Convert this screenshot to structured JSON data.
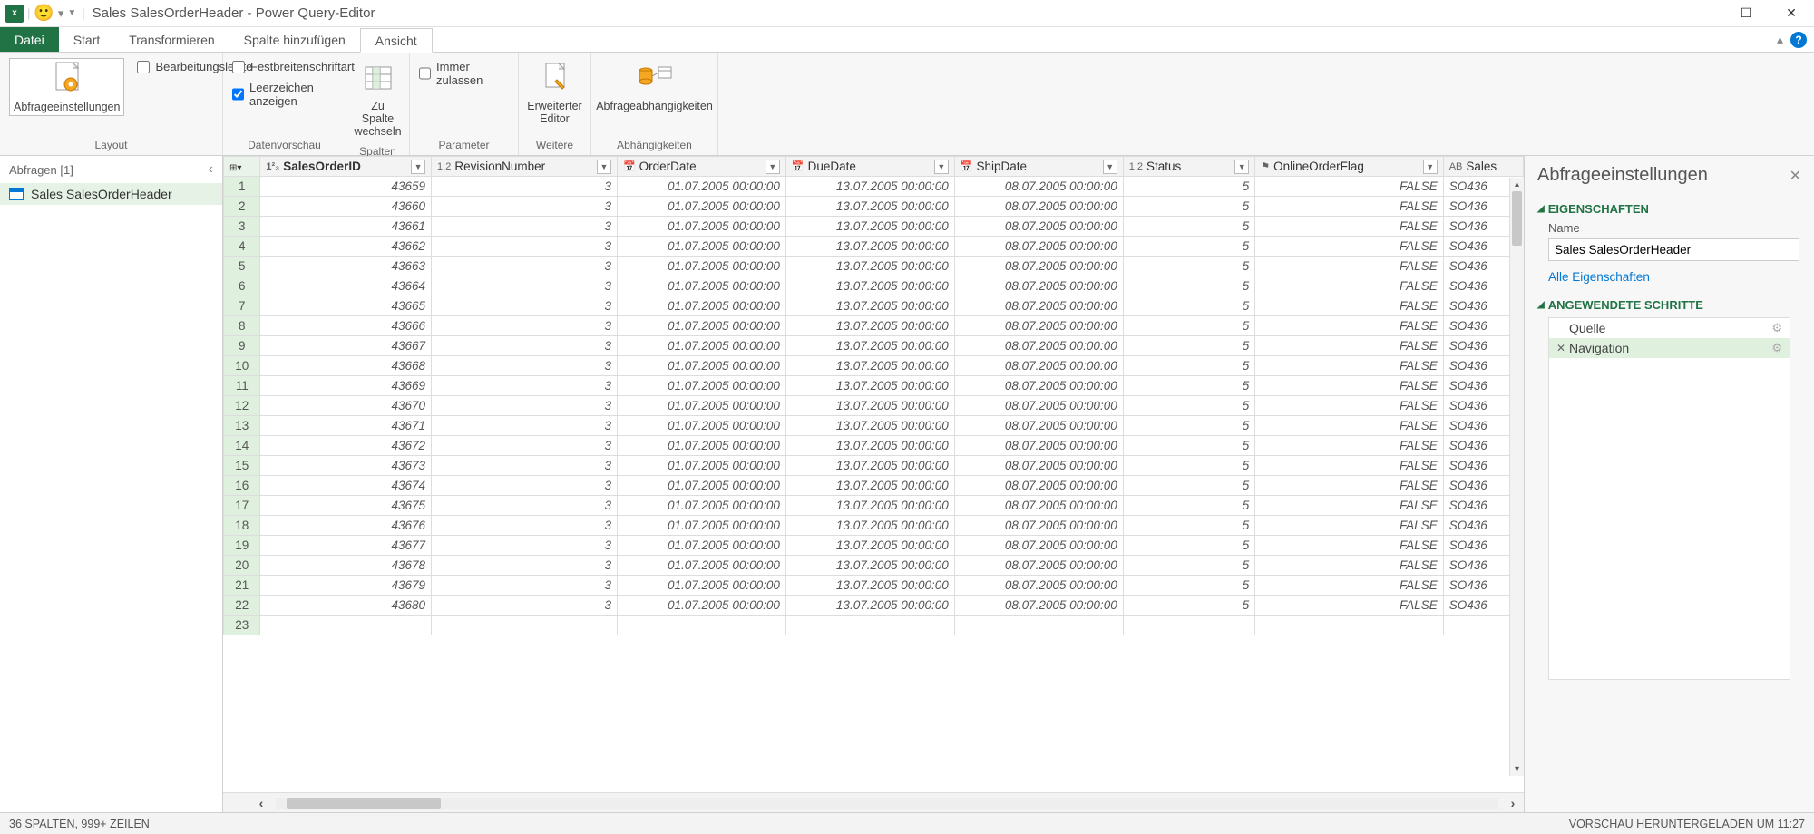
{
  "window": {
    "title": "Sales SalesOrderHeader - Power Query-Editor"
  },
  "tabs": {
    "file": "Datei",
    "start": "Start",
    "transform": "Transformieren",
    "addcol": "Spalte hinzufügen",
    "view": "Ansicht"
  },
  "ribbon": {
    "querySettings": "Abfrageeinstellungen",
    "formulaBar": "Bearbeitungsleiste",
    "monospace": "Festbreitenschriftart",
    "showWhitespace": "Leerzeichen anzeigen",
    "goToColumn": "Zu Spalte wechseln",
    "alwaysAllow": "Immer zulassen",
    "advancedEditor": "Erweiterter Editor",
    "dependencies": "Abfrageabhängigkeiten",
    "grp_layout": "Layout",
    "grp_preview": "Datenvorschau",
    "grp_columns": "Spalten",
    "grp_params": "Parameter",
    "grp_more": "Weitere",
    "grp_deps": "Abhängigkeiten"
  },
  "queries": {
    "header": "Abfragen [1]",
    "item": "Sales SalesOrderHeader"
  },
  "columns": [
    {
      "name": "SalesOrderID",
      "type": "1²₃"
    },
    {
      "name": "RevisionNumber",
      "type": "1.2"
    },
    {
      "name": "OrderDate",
      "type": "date"
    },
    {
      "name": "DueDate",
      "type": "date"
    },
    {
      "name": "ShipDate",
      "type": "date"
    },
    {
      "name": "Status",
      "type": "1.2"
    },
    {
      "name": "OnlineOrderFlag",
      "type": "flag"
    },
    {
      "name": "Sales",
      "type": "ABC"
    }
  ],
  "rows": [
    {
      "n": 1,
      "id": 43659,
      "rev": 3,
      "od": "01.07.2005 00:00:00",
      "dd": "13.07.2005 00:00:00",
      "sd": "08.07.2005 00:00:00",
      "st": 5,
      "fl": "FALSE",
      "so": "SO436"
    },
    {
      "n": 2,
      "id": 43660,
      "rev": 3,
      "od": "01.07.2005 00:00:00",
      "dd": "13.07.2005 00:00:00",
      "sd": "08.07.2005 00:00:00",
      "st": 5,
      "fl": "FALSE",
      "so": "SO436"
    },
    {
      "n": 3,
      "id": 43661,
      "rev": 3,
      "od": "01.07.2005 00:00:00",
      "dd": "13.07.2005 00:00:00",
      "sd": "08.07.2005 00:00:00",
      "st": 5,
      "fl": "FALSE",
      "so": "SO436"
    },
    {
      "n": 4,
      "id": 43662,
      "rev": 3,
      "od": "01.07.2005 00:00:00",
      "dd": "13.07.2005 00:00:00",
      "sd": "08.07.2005 00:00:00",
      "st": 5,
      "fl": "FALSE",
      "so": "SO436"
    },
    {
      "n": 5,
      "id": 43663,
      "rev": 3,
      "od": "01.07.2005 00:00:00",
      "dd": "13.07.2005 00:00:00",
      "sd": "08.07.2005 00:00:00",
      "st": 5,
      "fl": "FALSE",
      "so": "SO436"
    },
    {
      "n": 6,
      "id": 43664,
      "rev": 3,
      "od": "01.07.2005 00:00:00",
      "dd": "13.07.2005 00:00:00",
      "sd": "08.07.2005 00:00:00",
      "st": 5,
      "fl": "FALSE",
      "so": "SO436"
    },
    {
      "n": 7,
      "id": 43665,
      "rev": 3,
      "od": "01.07.2005 00:00:00",
      "dd": "13.07.2005 00:00:00",
      "sd": "08.07.2005 00:00:00",
      "st": 5,
      "fl": "FALSE",
      "so": "SO436"
    },
    {
      "n": 8,
      "id": 43666,
      "rev": 3,
      "od": "01.07.2005 00:00:00",
      "dd": "13.07.2005 00:00:00",
      "sd": "08.07.2005 00:00:00",
      "st": 5,
      "fl": "FALSE",
      "so": "SO436"
    },
    {
      "n": 9,
      "id": 43667,
      "rev": 3,
      "od": "01.07.2005 00:00:00",
      "dd": "13.07.2005 00:00:00",
      "sd": "08.07.2005 00:00:00",
      "st": 5,
      "fl": "FALSE",
      "so": "SO436"
    },
    {
      "n": 10,
      "id": 43668,
      "rev": 3,
      "od": "01.07.2005 00:00:00",
      "dd": "13.07.2005 00:00:00",
      "sd": "08.07.2005 00:00:00",
      "st": 5,
      "fl": "FALSE",
      "so": "SO436"
    },
    {
      "n": 11,
      "id": 43669,
      "rev": 3,
      "od": "01.07.2005 00:00:00",
      "dd": "13.07.2005 00:00:00",
      "sd": "08.07.2005 00:00:00",
      "st": 5,
      "fl": "FALSE",
      "so": "SO436"
    },
    {
      "n": 12,
      "id": 43670,
      "rev": 3,
      "od": "01.07.2005 00:00:00",
      "dd": "13.07.2005 00:00:00",
      "sd": "08.07.2005 00:00:00",
      "st": 5,
      "fl": "FALSE",
      "so": "SO436"
    },
    {
      "n": 13,
      "id": 43671,
      "rev": 3,
      "od": "01.07.2005 00:00:00",
      "dd": "13.07.2005 00:00:00",
      "sd": "08.07.2005 00:00:00",
      "st": 5,
      "fl": "FALSE",
      "so": "SO436"
    },
    {
      "n": 14,
      "id": 43672,
      "rev": 3,
      "od": "01.07.2005 00:00:00",
      "dd": "13.07.2005 00:00:00",
      "sd": "08.07.2005 00:00:00",
      "st": 5,
      "fl": "FALSE",
      "so": "SO436"
    },
    {
      "n": 15,
      "id": 43673,
      "rev": 3,
      "od": "01.07.2005 00:00:00",
      "dd": "13.07.2005 00:00:00",
      "sd": "08.07.2005 00:00:00",
      "st": 5,
      "fl": "FALSE",
      "so": "SO436"
    },
    {
      "n": 16,
      "id": 43674,
      "rev": 3,
      "od": "01.07.2005 00:00:00",
      "dd": "13.07.2005 00:00:00",
      "sd": "08.07.2005 00:00:00",
      "st": 5,
      "fl": "FALSE",
      "so": "SO436"
    },
    {
      "n": 17,
      "id": 43675,
      "rev": 3,
      "od": "01.07.2005 00:00:00",
      "dd": "13.07.2005 00:00:00",
      "sd": "08.07.2005 00:00:00",
      "st": 5,
      "fl": "FALSE",
      "so": "SO436"
    },
    {
      "n": 18,
      "id": 43676,
      "rev": 3,
      "od": "01.07.2005 00:00:00",
      "dd": "13.07.2005 00:00:00",
      "sd": "08.07.2005 00:00:00",
      "st": 5,
      "fl": "FALSE",
      "so": "SO436"
    },
    {
      "n": 19,
      "id": 43677,
      "rev": 3,
      "od": "01.07.2005 00:00:00",
      "dd": "13.07.2005 00:00:00",
      "sd": "08.07.2005 00:00:00",
      "st": 5,
      "fl": "FALSE",
      "so": "SO436"
    },
    {
      "n": 20,
      "id": 43678,
      "rev": 3,
      "od": "01.07.2005 00:00:00",
      "dd": "13.07.2005 00:00:00",
      "sd": "08.07.2005 00:00:00",
      "st": 5,
      "fl": "FALSE",
      "so": "SO436"
    },
    {
      "n": 21,
      "id": 43679,
      "rev": 3,
      "od": "01.07.2005 00:00:00",
      "dd": "13.07.2005 00:00:00",
      "sd": "08.07.2005 00:00:00",
      "st": 5,
      "fl": "FALSE",
      "so": "SO436"
    },
    {
      "n": 22,
      "id": 43680,
      "rev": 3,
      "od": "01.07.2005 00:00:00",
      "dd": "13.07.2005 00:00:00",
      "sd": "08.07.2005 00:00:00",
      "st": 5,
      "fl": "FALSE",
      "so": "SO436"
    },
    {
      "n": 23,
      "id": "",
      "rev": "",
      "od": "",
      "dd": "",
      "sd": "",
      "st": "",
      "fl": "",
      "so": ""
    }
  ],
  "settings": {
    "title": "Abfrageeinstellungen",
    "props": "EIGENSCHAFTEN",
    "nameLabel": "Name",
    "nameValue": "Sales SalesOrderHeader",
    "allProps": "Alle Eigenschaften",
    "steps": "ANGEWENDETE SCHRITTE",
    "step1": "Quelle",
    "step2": "Navigation"
  },
  "status": {
    "left": "36 SPALTEN, 999+ ZEILEN",
    "right": "VORSCHAU HERUNTERGELADEN UM 11:27"
  }
}
